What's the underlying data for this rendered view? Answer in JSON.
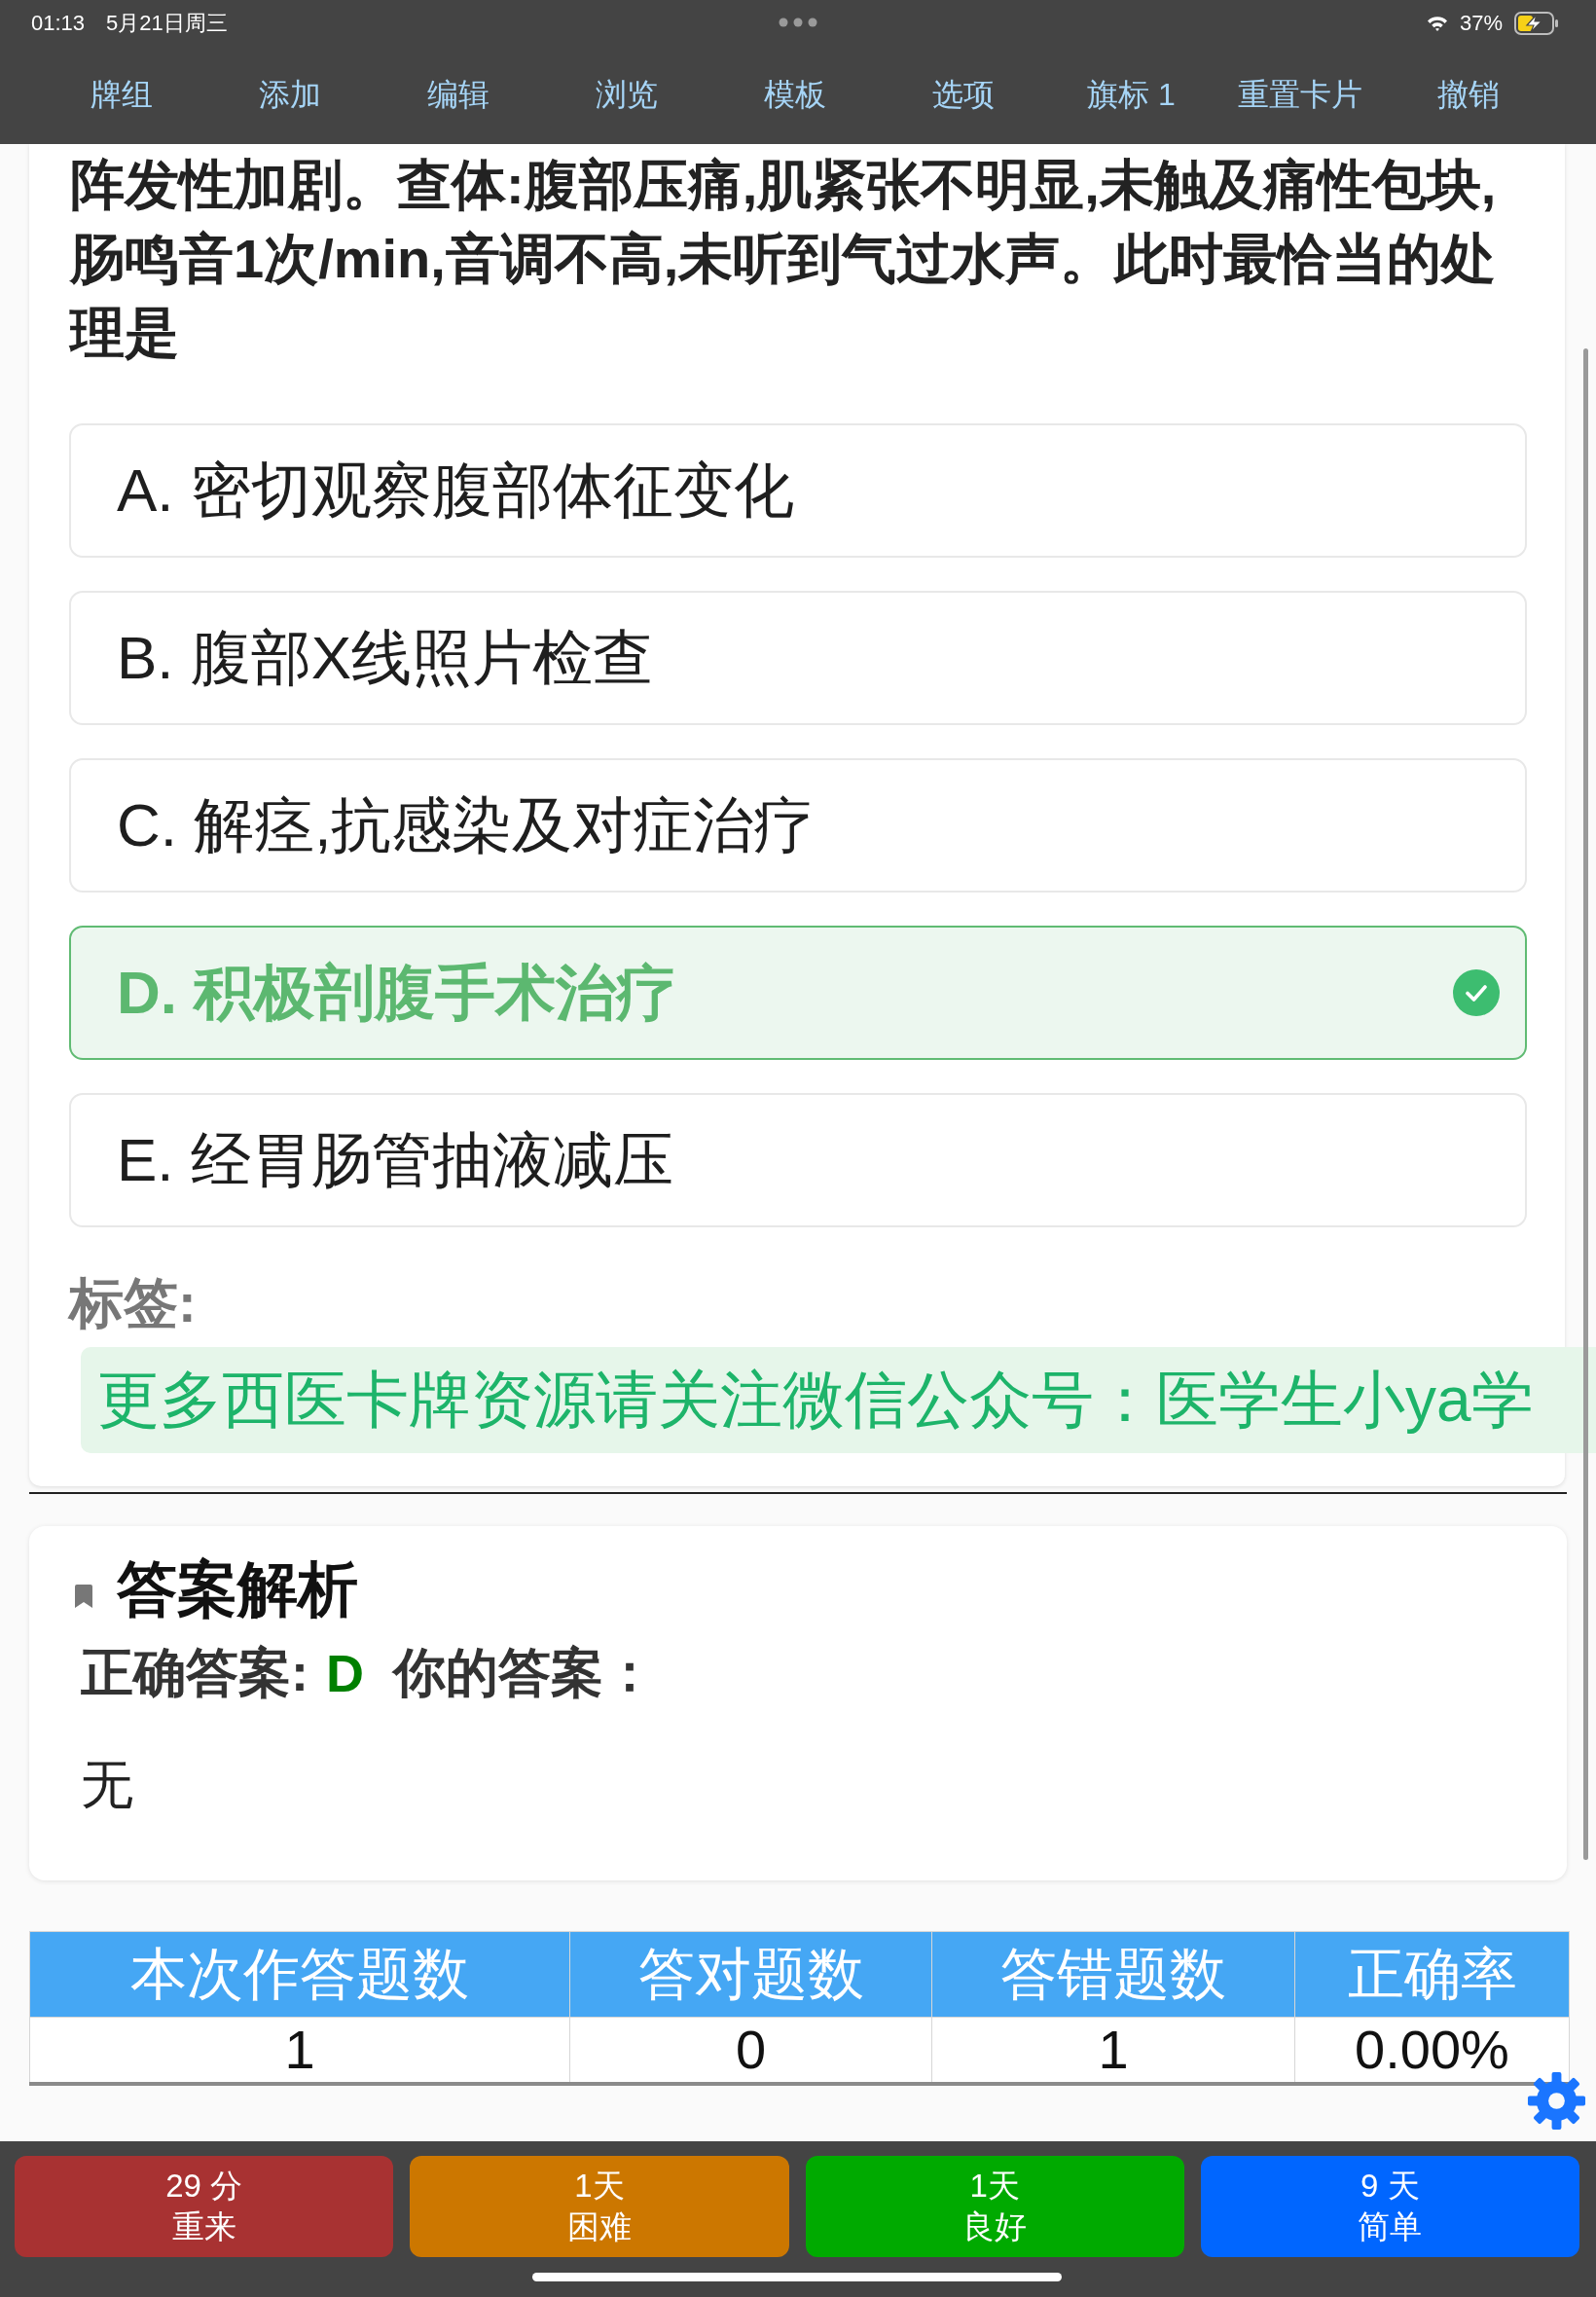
{
  "status_bar": {
    "time": "01:13",
    "date": "5月21日周三",
    "battery": "37%"
  },
  "toolbar": [
    "牌组",
    "添加",
    "编辑",
    "浏览",
    "模板",
    "选项",
    "旗标 1",
    "重置卡片",
    "撤销"
  ],
  "question": {
    "text": "阵发性加剧。查体:腹部压痛,肌紧张不明显,未触及痛性包块,肠鸣音1次/min,音调不高,未听到气过水声。此时最恰当的处理是"
  },
  "options": [
    {
      "label": "A. 密切观察腹部体征变化",
      "correct": false
    },
    {
      "label": "B. 腹部X线照片检查",
      "correct": false
    },
    {
      "label": "C. 解痉,抗感染及对症治疗",
      "correct": false
    },
    {
      "label": "D. 积极剖腹手术治疗",
      "correct": true
    },
    {
      "label": "E. 经胃肠管抽液减压",
      "correct": false
    }
  ],
  "tags": {
    "label": "标签:",
    "items": [
      "更多西医卡牌资源请关注微信公众号：医学生小ya学"
    ]
  },
  "analysis": {
    "title": "答案解析",
    "correct_answer_label": "正确答案:",
    "correct_answer": "D",
    "your_answer_label": "你的答案：",
    "explanation": "无"
  },
  "stats": {
    "columns": [
      "本次作答题数",
      "答对题数",
      "答错题数",
      "正确率"
    ],
    "rows": [
      [
        "1",
        "0",
        "1",
        "0.00%"
      ]
    ]
  },
  "review_buttons": [
    {
      "interval": "29 分",
      "label": "重来",
      "color": "#a83232"
    },
    {
      "interval": "1天",
      "label": "困难",
      "color": "#cc7700"
    },
    {
      "interval": "1天",
      "label": "良好",
      "color": "#00aa00"
    },
    {
      "interval": "9 天",
      "label": "简单",
      "color": "#0066ff"
    }
  ]
}
